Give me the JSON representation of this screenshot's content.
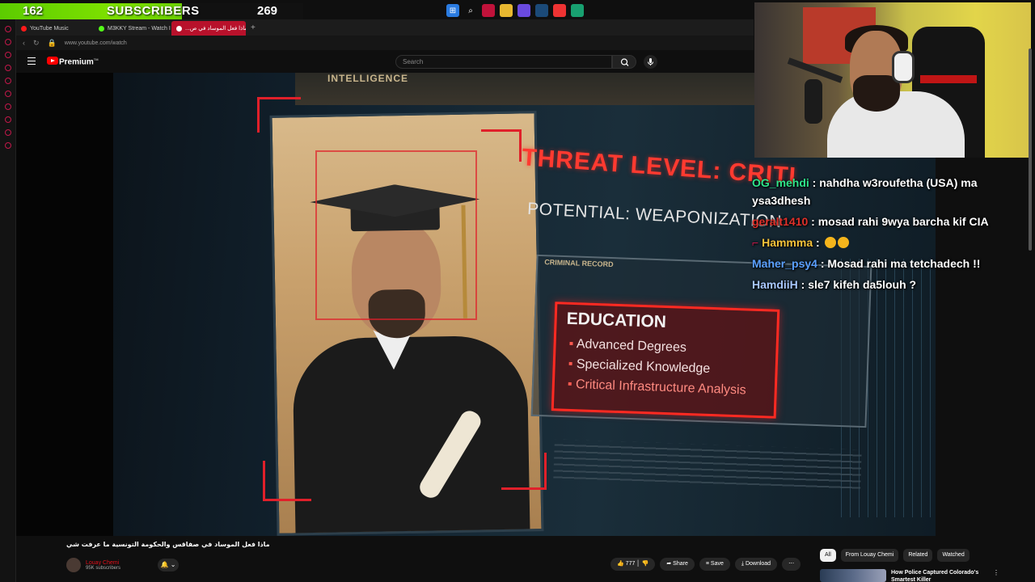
{
  "sub_goal": {
    "current": "162",
    "label": "SUBSCRIBERS",
    "goal": "269",
    "progress": 0.6,
    "bar_color": "#6fd600"
  },
  "taskbar_icons": [
    "windows-start-icon",
    "search-icon",
    "app-icon",
    "folder-icon",
    "discord-icon",
    "steam-icon",
    "chrome-icon",
    "app-icon-2"
  ],
  "browser": {
    "tabs": [
      {
        "label": "YouTube Music",
        "icon_color": "#ff1a1a"
      },
      {
        "label": "M3KKY Stream - Watch I",
        "icon_color": "#53fc18"
      },
      {
        "label": "ماذا فعل الموساد في ص...",
        "icon_color": "#ff1a1a",
        "active": true
      }
    ],
    "url": "www.youtube.com/watch"
  },
  "youtube": {
    "brand": "Premium",
    "brand_sup": "TM",
    "search_placeholder": "Search"
  },
  "video_frame": {
    "header_text": "INTELLIGENCE",
    "threat": "THREAT LEVEL: CRITI",
    "potential": "POTENTIAL: WEAPONIZATION",
    "criminal_record": "CRIMINAL RECORD",
    "education_title": "EDUCATION",
    "education_items": [
      "Advanced Degrees",
      "Specialized Knowledge",
      "Critical Infrastructure Analysis"
    ]
  },
  "chat": [
    {
      "user": "OG_mehdi",
      "color": "#2ee58a",
      "text": "nahdha w3roufetha (USA) ma ysa3dhesh"
    },
    {
      "user": "geralt1410",
      "color": "#e0302a",
      "text": "mosad rahi 9wya barcha kif CIA"
    },
    {
      "user": "Hammma",
      "color": "#f5c23a",
      "text": "",
      "emotes": 2
    },
    {
      "user": "Maher_psy4",
      "color": "#5aa0ff",
      "text": "Mosad rahi ma tetchadech !!"
    },
    {
      "user": "HamdiiH",
      "color": "#a8c8ff",
      "text": "sle7 kifeh da5louh ?"
    }
  ],
  "video_info": {
    "title": "ماذا فعل الموساد في صفاقس والحكومة التونسية ما عرفت شي",
    "channel": "Louay Chemi",
    "subscribers": "95K subscribers",
    "likes": "777",
    "share": "Share",
    "save": "Save",
    "download": "Download"
  },
  "sidebar_chips": [
    "All",
    "From Louay Chemi",
    "Related",
    "Watched"
  ],
  "related": {
    "title": "How Police Captured Colorado's Smartest Killer"
  }
}
